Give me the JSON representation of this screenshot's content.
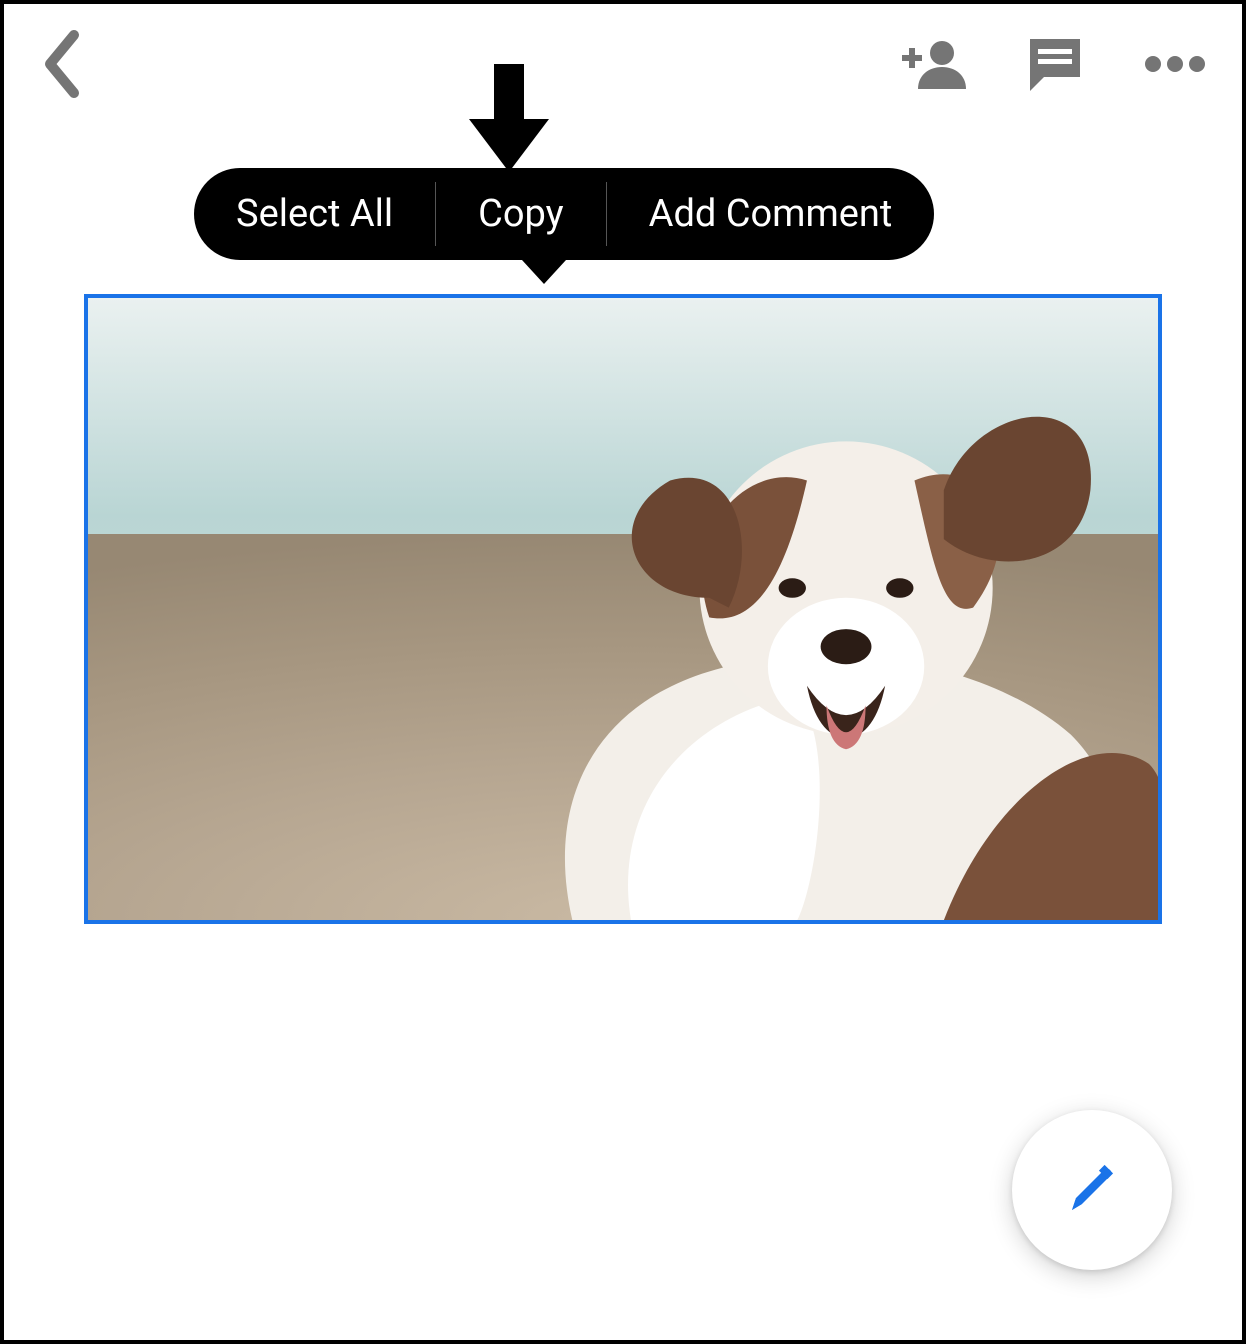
{
  "colors": {
    "selection": "#1a73e8",
    "icon_grey": "#757575",
    "menu_bg": "#000000",
    "fab_pencil": "#1a73e8"
  },
  "topbar": {
    "back_icon": "chevron-left",
    "actions": {
      "add_person_icon": "person-add",
      "comment_icon": "comment",
      "overflow_icon": "more-horizontal"
    }
  },
  "hint": {
    "arrow_icon": "arrow-down",
    "points_to": "context_menu.items.1"
  },
  "context_menu": {
    "items": [
      {
        "label": "Select All"
      },
      {
        "label": "Copy"
      },
      {
        "label": "Add Comment"
      }
    ]
  },
  "document": {
    "selected_object": {
      "type": "image",
      "description": "photo of a brown-and-white dog (Australian Shepherd) on a blurred beach background",
      "selected": true
    }
  },
  "fab": {
    "edit_icon": "pencil"
  }
}
